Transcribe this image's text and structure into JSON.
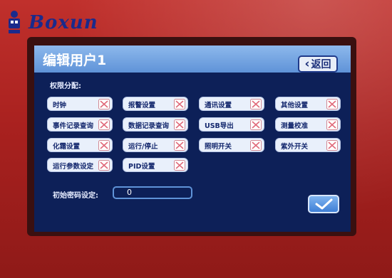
{
  "brand": {
    "name": "Boxun",
    "color": "#1a2a8c"
  },
  "screen": {
    "title": "编辑用户1",
    "back_label": "返回",
    "permissions_label": "权限分配:",
    "permissions": [
      {
        "label": "时钟",
        "checked": false
      },
      {
        "label": "报警设置",
        "checked": false
      },
      {
        "label": "通讯设置",
        "checked": false
      },
      {
        "label": "其他设置",
        "checked": false
      },
      {
        "label": "事件记录查询",
        "checked": false
      },
      {
        "label": "数据记录查询",
        "checked": false
      },
      {
        "label": "USB导出",
        "checked": false
      },
      {
        "label": "测量校准",
        "checked": false
      },
      {
        "label": "化霜设置",
        "checked": false
      },
      {
        "label": "运行/停止",
        "checked": false
      },
      {
        "label": "照明开关",
        "checked": false
      },
      {
        "label": "紫外开关",
        "checked": false
      },
      {
        "label": "运行参数设定",
        "checked": false
      },
      {
        "label": "PID设置",
        "checked": false
      }
    ],
    "password_label": "初始密码设定:",
    "password_value": "0",
    "confirm_icon": "checkmark-icon",
    "colors": {
      "bezel": "#a9211f",
      "screen_bg": "#0d2058",
      "title_bar": "#6a9ddc",
      "unchecked_x": "#e06a7a"
    }
  }
}
